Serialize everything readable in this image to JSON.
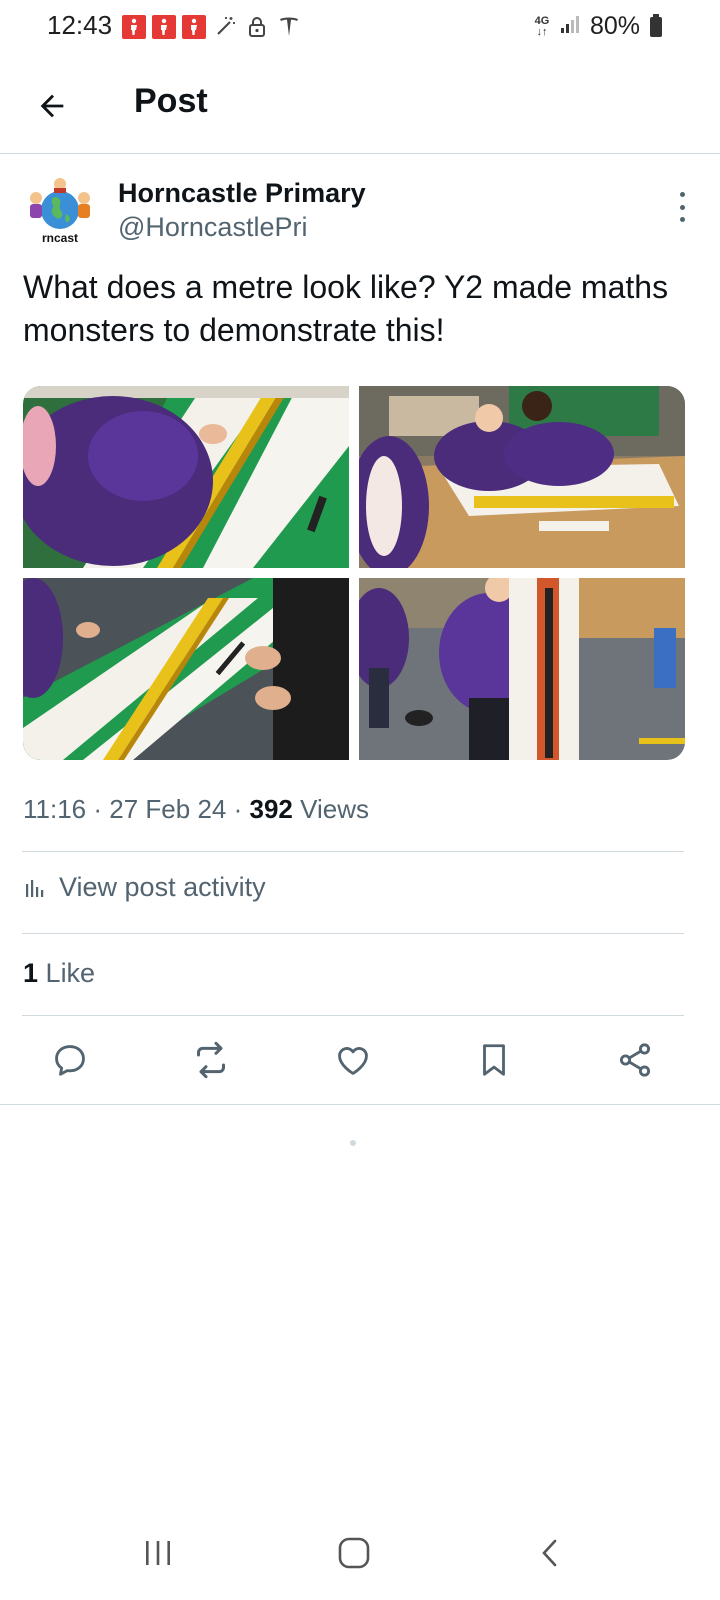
{
  "status_bar": {
    "time": "12:43",
    "network": "4G",
    "battery_text": "80%"
  },
  "header": {
    "title": "Post",
    "back_icon": "arrow-left-icon"
  },
  "author": {
    "name": "Horncastle Primary",
    "handle": "@HorncastlePri",
    "avatar_text": "rncast"
  },
  "post": {
    "text": "What does a metre look like? Y2 made maths monsters to demonstrate this!"
  },
  "meta": {
    "time": "11:16",
    "date": "27 Feb 24",
    "views_count": "392",
    "views_label": "Views",
    "separator": "·"
  },
  "activity": {
    "label": "View post activity"
  },
  "likes": {
    "count": "1",
    "label": "Like"
  },
  "colors": {
    "text_primary": "#0f1419",
    "text_secondary": "#536471",
    "divider": "#cfd9de",
    "notification_red": "#e53935"
  }
}
